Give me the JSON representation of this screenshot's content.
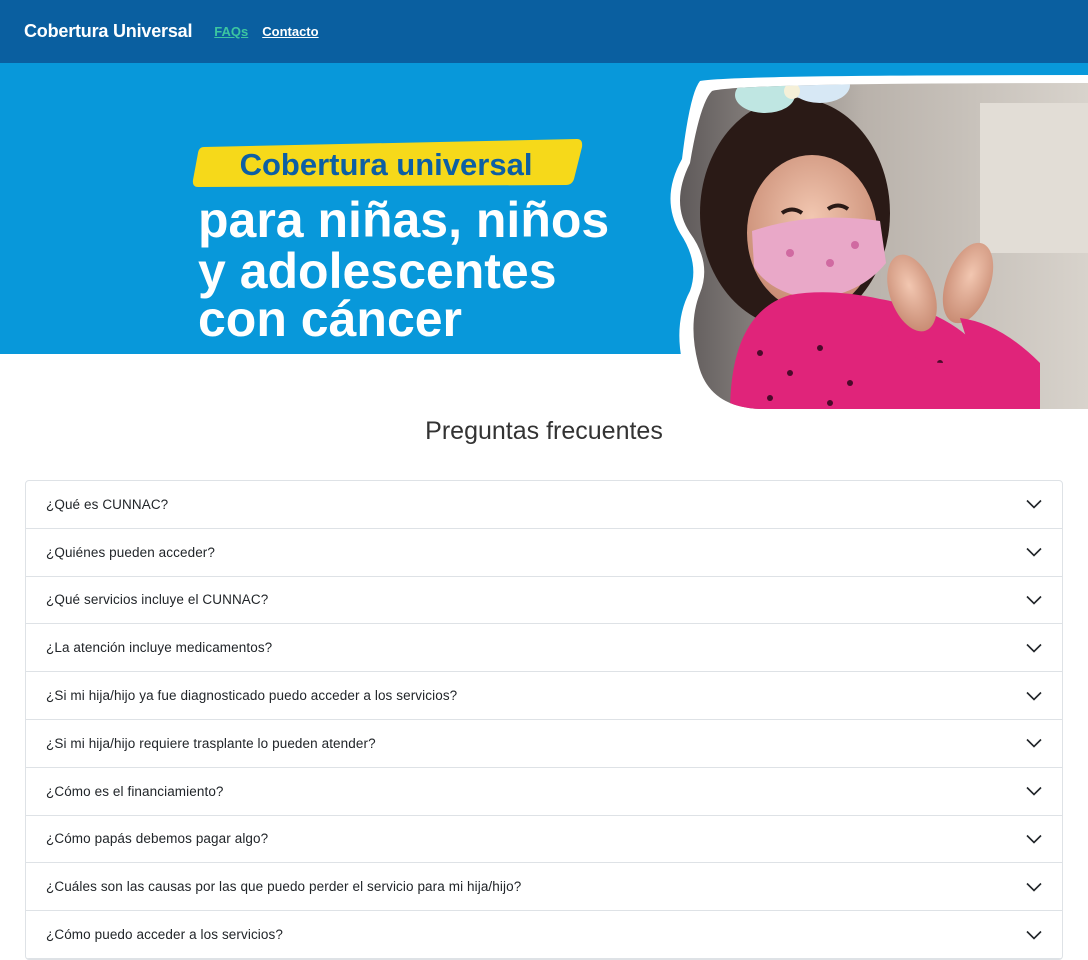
{
  "navbar": {
    "brand": "Cobertura Universal",
    "links": [
      {
        "label": "FAQs",
        "active": true
      },
      {
        "label": "Contacto",
        "active": false
      }
    ]
  },
  "hero": {
    "badge_text": "Cobertura universal",
    "headline_lines": [
      "para niñas, niños",
      "y adolescentes",
      "con cáncer"
    ],
    "image": "smiling-child-with-face-mask-photo"
  },
  "faq": {
    "title": "Preguntas frecuentes",
    "items": [
      {
        "question": "¿Qué es CUNNAC?"
      },
      {
        "question": "¿Quiénes pueden acceder?"
      },
      {
        "question": "¿Qué servicios incluye el CUNNAC?"
      },
      {
        "question": "¿La atención incluye medicamentos?"
      },
      {
        "question": "¿Si mi hija/hijo ya fue diagnosticado puedo acceder a los servicios?"
      },
      {
        "question": "¿Si mi hija/hijo requiere trasplante lo pueden atender?"
      },
      {
        "question": "¿Cómo es el financiamiento?"
      },
      {
        "question": "¿Cómo papás debemos pagar algo?"
      },
      {
        "question": "¿Cuáles son las causas por las que puedo perder el servicio para mi hija/hijo?"
      },
      {
        "question": "¿Cómo puedo acceder a los servicios?"
      }
    ],
    "expand_icon": "chevron-down-icon"
  },
  "colors": {
    "navbar_bg": "#0a5fa0",
    "active_link": "#3cc6a0",
    "hero_blue": "#0898da",
    "badge_yellow": "#f6d91a",
    "badge_text": "#0d5fa4"
  }
}
